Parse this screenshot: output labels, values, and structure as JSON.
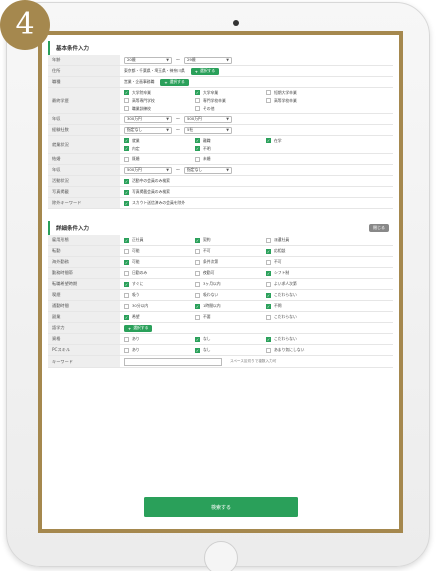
{
  "step_badge": "4",
  "basic_section": {
    "title": "基本条件入力",
    "rows": [
      {
        "label": "年齢",
        "type": "range",
        "from": "20歳",
        "to": "29歳"
      },
      {
        "label": "住所",
        "type": "text_button",
        "text": "東京都・千葉県・埼玉県・神奈川県",
        "button": "選択する"
      },
      {
        "label": "職種",
        "type": "text_button",
        "text": "営業・企画事務職",
        "button": "選択する"
      },
      {
        "label": "最終学歴",
        "type": "checks",
        "items": [
          {
            "label": "大学院卒業",
            "on": true
          },
          {
            "label": "大学卒業",
            "on": true
          },
          {
            "label": "短期大学卒業",
            "on": false
          },
          {
            "label": "高等専門学校",
            "on": false
          },
          {
            "label": "専門学校卒業",
            "on": false
          },
          {
            "label": "高等学校卒業",
            "on": false
          },
          {
            "label": "職業訓練校",
            "on": false
          },
          {
            "label": "その他",
            "on": false
          }
        ]
      },
      {
        "label": "年収",
        "type": "range",
        "from": "300万円",
        "to": "500万円"
      },
      {
        "label": "経験社数",
        "type": "range",
        "from": "指定なし",
        "to": "5社"
      },
      {
        "label": "就業状況",
        "type": "checks",
        "items": [
          {
            "label": "就業",
            "on": true
          },
          {
            "label": "離職",
            "on": true
          },
          {
            "label": "在学",
            "on": true
          },
          {
            "label": "内定",
            "on": true
          },
          {
            "label": "不明",
            "on": true
          }
        ]
      },
      {
        "label": "結婚",
        "type": "checks",
        "items": [
          {
            "label": "既婚",
            "on": false
          },
          {
            "label": "未婚",
            "on": false
          }
        ]
      },
      {
        "label": "年収",
        "type": "range",
        "from": "500万円",
        "to": "指定なし"
      },
      {
        "label": "活動状況",
        "type": "checks",
        "items": [
          {
            "label": "活動中の会員のみ検索",
            "on": true,
            "wide": true
          }
        ]
      },
      {
        "label": "写真掲載",
        "type": "checks",
        "items": [
          {
            "label": "写真掲載会員のみ検索",
            "on": true,
            "wide": true
          }
        ]
      },
      {
        "label": "除外キーワード",
        "type": "checks",
        "items": [
          {
            "label": "スカウト送信済みの会員を除外",
            "on": true,
            "wide": true
          }
        ]
      }
    ]
  },
  "detail_section": {
    "title": "詳細条件入力",
    "close_label": "閉じる",
    "rows": [
      {
        "label": "雇用形態",
        "type": "checks",
        "items": [
          {
            "label": "正社員",
            "on": true
          },
          {
            "label": "契約",
            "on": true
          },
          {
            "label": "派遣社員",
            "on": false
          }
        ]
      },
      {
        "label": "転勤",
        "type": "checks",
        "items": [
          {
            "label": "可能",
            "on": false
          },
          {
            "label": "不可",
            "on": false
          },
          {
            "label": "応相談",
            "on": true
          }
        ]
      },
      {
        "label": "海外勤務",
        "type": "checks",
        "items": [
          {
            "label": "可能",
            "on": true
          },
          {
            "label": "条件次第",
            "on": false
          },
          {
            "label": "不可",
            "on": false
          }
        ]
      },
      {
        "label": "勤務時間帯",
        "type": "checks",
        "items": [
          {
            "label": "日勤のみ",
            "on": false
          },
          {
            "label": "夜勤可",
            "on": false
          },
          {
            "label": "シフト制",
            "on": true
          }
        ]
      },
      {
        "label": "転職希望時期",
        "type": "checks",
        "items": [
          {
            "label": "すぐに",
            "on": true
          },
          {
            "label": "3ヶ月以内",
            "on": false
          },
          {
            "label": "よい求人次第",
            "on": false
          }
        ]
      },
      {
        "label": "喫煙",
        "type": "checks",
        "items": [
          {
            "label": "吸う",
            "on": false
          },
          {
            "label": "吸わない",
            "on": false
          },
          {
            "label": "こだわらない",
            "on": true
          }
        ]
      },
      {
        "label": "通勤時間",
        "type": "checks",
        "items": [
          {
            "label": "30分以内",
            "on": false
          },
          {
            "label": "1時間以内",
            "on": true
          },
          {
            "label": "不問",
            "on": true
          }
        ]
      },
      {
        "label": "副業",
        "type": "checks",
        "items": [
          {
            "label": "希望",
            "on": true
          },
          {
            "label": "不要",
            "on": false
          },
          {
            "label": "こだわらない",
            "on": false
          }
        ]
      },
      {
        "label": "語学力",
        "type": "text_button",
        "text": "",
        "button": "選択する"
      },
      {
        "label": "資格",
        "type": "checks",
        "items": [
          {
            "label": "あり",
            "on": false
          },
          {
            "label": "なし",
            "on": true
          },
          {
            "label": "こだわらない",
            "on": true
          }
        ]
      },
      {
        "label": "PCスキル",
        "type": "checks",
        "items": [
          {
            "label": "あり",
            "on": false
          },
          {
            "label": "なし",
            "on": true
          },
          {
            "label": "あまり気にしない",
            "on": false
          }
        ]
      },
      {
        "label": "キーワード",
        "type": "keyword",
        "hint": "スペース区切りで複数入力可"
      }
    ]
  },
  "search_button": "検索する"
}
